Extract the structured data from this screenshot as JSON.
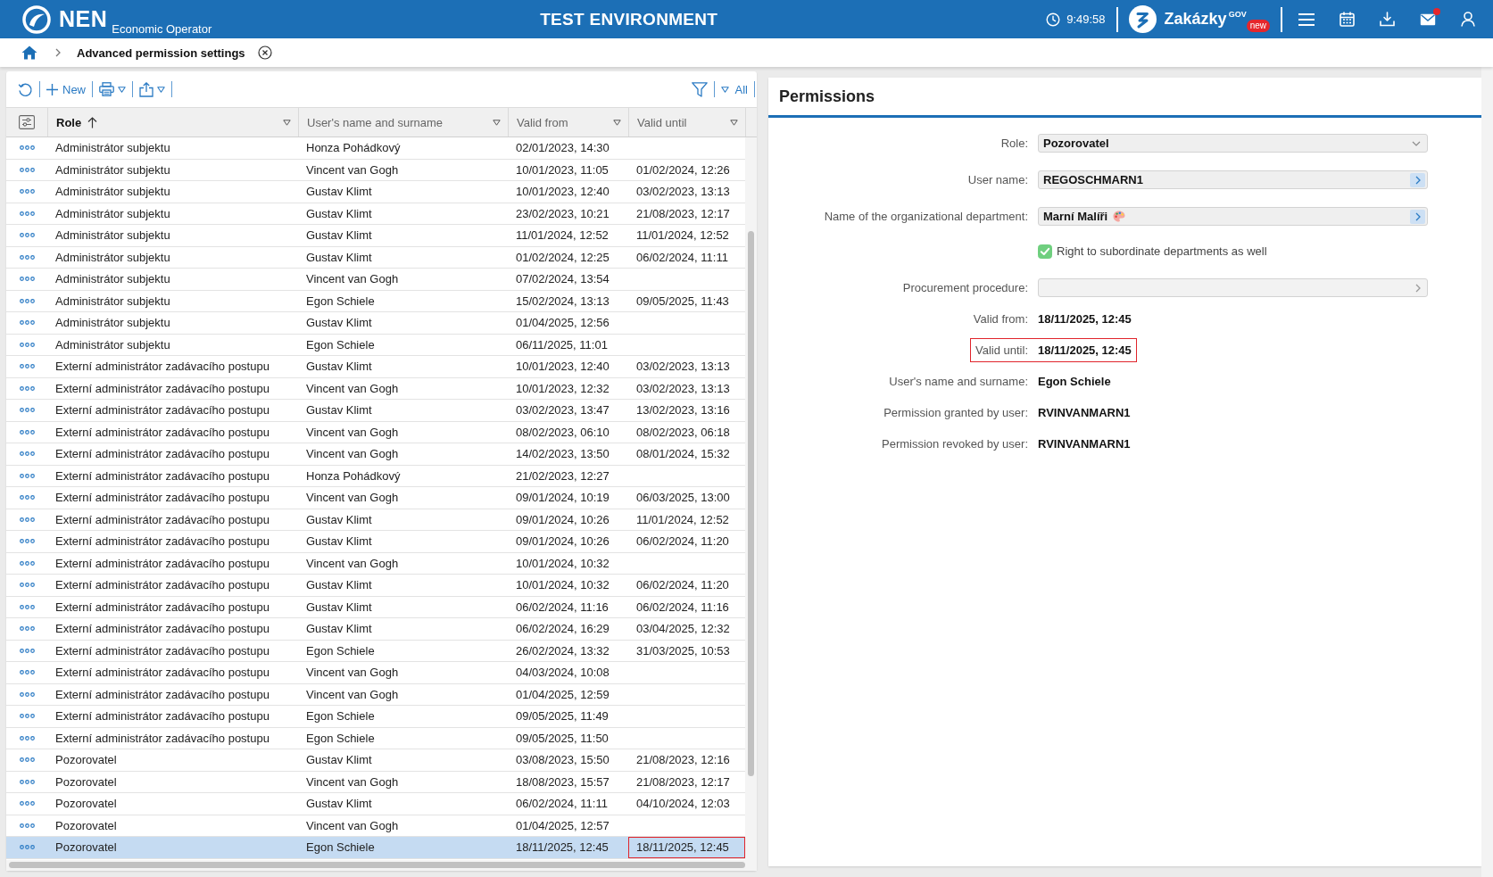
{
  "top_bar": {
    "logo": "NEN",
    "subtitle": "Economic Operator",
    "environment": "TEST ENVIRONMENT",
    "time": "9:49:58",
    "app_name": "Zakázky",
    "app_suffix": "GOV",
    "app_badge": "new",
    "mail_unread": true
  },
  "breadcrumb": {
    "current": "Advanced permission settings"
  },
  "toolbar": {
    "new_label": "New",
    "filter_label": "All"
  },
  "table": {
    "columns": [
      {
        "label": "Role",
        "sorted": true
      },
      {
        "label": "User's name and surname",
        "sorted": false
      },
      {
        "label": "Valid from",
        "sorted": false
      },
      {
        "label": "Valid until",
        "sorted": false
      }
    ],
    "rows": [
      {
        "role": "Administrátor subjektu",
        "user": "Honza Pohádkový",
        "valid_from": "02/01/2023, 14:30",
        "selected": false,
        "highlighted": false
      },
      {
        "role": "Administrátor subjektu",
        "user": "Vincent van Gogh",
        "valid_from": "10/01/2023, 11:05",
        "valid_until": "01/02/2024, 12:26",
        "selected": false,
        "highlighted": false
      },
      {
        "role": "Administrátor subjektu",
        "user": "Gustav Klimt",
        "valid_from": "10/01/2023, 12:40",
        "valid_until": "03/02/2023, 13:13",
        "selected": false,
        "highlighted": false
      },
      {
        "role": "Administrátor subjektu",
        "user": "Gustav Klimt",
        "valid_from": "23/02/2023, 10:21",
        "valid_until": "21/08/2023, 12:17",
        "selected": false,
        "highlighted": false
      },
      {
        "role": "Administrátor subjektu",
        "user": "Gustav Klimt",
        "valid_from": "11/01/2024, 12:52",
        "valid_until": "11/01/2024, 12:52",
        "selected": false,
        "highlighted": false
      },
      {
        "role": "Administrátor subjektu",
        "user": "Gustav Klimt",
        "valid_from": "01/02/2024, 12:25",
        "valid_until": "06/02/2024, 11:11",
        "selected": false,
        "highlighted": false
      },
      {
        "role": "Administrátor subjektu",
        "user": "Vincent van Gogh",
        "valid_from": "07/02/2024, 13:54",
        "selected": false,
        "highlighted": false
      },
      {
        "role": "Administrátor subjektu",
        "user": "Egon Schiele",
        "valid_from": "15/02/2024, 13:13",
        "valid_until": "09/05/2025, 11:43",
        "selected": false,
        "highlighted": false
      },
      {
        "role": "Administrátor subjektu",
        "user": "Gustav Klimt",
        "valid_from": "01/04/2025, 12:56",
        "selected": false,
        "highlighted": false
      },
      {
        "role": "Administrátor subjektu",
        "user": "Egon Schiele",
        "valid_from": "06/11/2025, 11:01",
        "selected": false,
        "highlighted": false
      },
      {
        "role": "Externí administrátor zadávacího postupu",
        "user": "Gustav Klimt",
        "valid_from": "10/01/2023, 12:40",
        "valid_until": "03/02/2023, 13:13",
        "selected": false,
        "highlighted": false
      },
      {
        "role": "Externí administrátor zadávacího postupu",
        "user": "Vincent van Gogh",
        "valid_from": "10/01/2023, 12:32",
        "valid_until": "03/02/2023, 13:13",
        "selected": false,
        "highlighted": false
      },
      {
        "role": "Externí administrátor zadávacího postupu",
        "user": "Gustav Klimt",
        "valid_from": "03/02/2023, 13:47",
        "valid_until": "13/02/2023, 13:16",
        "selected": false,
        "highlighted": false
      },
      {
        "role": "Externí administrátor zadávacího postupu",
        "user": "Vincent van Gogh",
        "valid_from": "08/02/2023, 06:10",
        "valid_until": "08/02/2023, 06:18",
        "selected": false,
        "highlighted": false
      },
      {
        "role": "Externí administrátor zadávacího postupu",
        "user": "Vincent van Gogh",
        "valid_from": "14/02/2023, 13:50",
        "valid_until": "08/01/2024, 15:32",
        "selected": false,
        "highlighted": false
      },
      {
        "role": "Externí administrátor zadávacího postupu",
        "user": "Honza Pohádkový",
        "valid_from": "21/02/2023, 12:27",
        "selected": false,
        "highlighted": false
      },
      {
        "role": "Externí administrátor zadávacího postupu",
        "user": "Vincent van Gogh",
        "valid_from": "09/01/2024, 10:19",
        "valid_until": "06/03/2025, 13:00",
        "selected": false,
        "highlighted": false
      },
      {
        "role": "Externí administrátor zadávacího postupu",
        "user": "Gustav Klimt",
        "valid_from": "09/01/2024, 10:26",
        "valid_until": "11/01/2024, 12:52",
        "selected": false,
        "highlighted": false
      },
      {
        "role": "Externí administrátor zadávacího postupu",
        "user": "Gustav Klimt",
        "valid_from": "09/01/2024, 10:26",
        "valid_until": "06/02/2024, 11:20",
        "selected": false,
        "highlighted": false
      },
      {
        "role": "Externí administrátor zadávacího postupu",
        "user": "Vincent van Gogh",
        "valid_from": "10/01/2024, 10:32",
        "selected": false,
        "highlighted": false
      },
      {
        "role": "Externí administrátor zadávacího postupu",
        "user": "Gustav Klimt",
        "valid_from": "10/01/2024, 10:32",
        "valid_until": "06/02/2024, 11:20",
        "selected": false,
        "highlighted": false
      },
      {
        "role": "Externí administrátor zadávacího postupu",
        "user": "Gustav Klimt",
        "valid_from": "06/02/2024, 11:16",
        "valid_until": "06/02/2024, 11:16",
        "selected": false,
        "highlighted": false
      },
      {
        "role": "Externí administrátor zadávacího postupu",
        "user": "Gustav Klimt",
        "valid_from": "06/02/2024, 16:29",
        "valid_until": "03/04/2025, 12:32",
        "selected": false,
        "highlighted": false
      },
      {
        "role": "Externí administrátor zadávacího postupu",
        "user": "Egon Schiele",
        "valid_from": "26/02/2024, 13:32",
        "valid_until": "31/03/2025, 10:53",
        "selected": false,
        "highlighted": false
      },
      {
        "role": "Externí administrátor zadávacího postupu",
        "user": "Vincent van Gogh",
        "valid_from": "04/03/2024, 10:08",
        "selected": false,
        "highlighted": false
      },
      {
        "role": "Externí administrátor zadávacího postupu",
        "user": "Vincent van Gogh",
        "valid_from": "01/04/2025, 12:59",
        "selected": false,
        "highlighted": false
      },
      {
        "role": "Externí administrátor zadávacího postupu",
        "user": "Egon Schiele",
        "valid_from": "09/05/2025, 11:49",
        "selected": false,
        "highlighted": false
      },
      {
        "role": "Externí administrátor zadávacího postupu",
        "user": "Egon Schiele",
        "valid_from": "09/05/2025, 11:50",
        "selected": false,
        "highlighted": false
      },
      {
        "role": "Pozorovatel",
        "user": "Gustav Klimt",
        "valid_from": "03/08/2023, 15:50",
        "valid_until": "21/08/2023, 12:16",
        "selected": false,
        "highlighted": false
      },
      {
        "role": "Pozorovatel",
        "user": "Vincent van Gogh",
        "valid_from": "18/08/2023, 15:57",
        "valid_until": "21/08/2023, 12:17",
        "selected": false,
        "highlighted": false
      },
      {
        "role": "Pozorovatel",
        "user": "Gustav Klimt",
        "valid_from": "06/02/2024, 11:11",
        "valid_until": "04/10/2024, 12:03",
        "selected": false,
        "highlighted": false
      },
      {
        "role": "Pozorovatel",
        "user": "Vincent van Gogh",
        "valid_from": "01/04/2025, 12:57",
        "selected": false,
        "highlighted": false
      },
      {
        "role": "Pozorovatel",
        "user": "Egon Schiele",
        "valid_from": "18/11/2025, 12:45",
        "valid_until": "18/11/2025, 12:45",
        "selected": true,
        "highlighted": true
      }
    ]
  },
  "permissions": {
    "title": "Permissions",
    "fields": [
      {
        "kind": "select",
        "label": "Role:",
        "value": "Pozorovatel"
      },
      {
        "kind": "lookup",
        "label": "User name:",
        "value": "REGOSCHMARN1",
        "disabled": false,
        "has_icon": false
      },
      {
        "kind": "lookup",
        "label": "Name of the organizational department:",
        "value": "Marní Malíři",
        "disabled": false,
        "has_icon": true
      },
      {
        "kind": "checkbox",
        "label": "Right to subordinate departments as well",
        "checked": true
      },
      {
        "kind": "lookup",
        "label": "Procurement procedure:",
        "disabled": true,
        "has_icon": false
      },
      {
        "kind": "text",
        "label": "Valid from:",
        "value": "18/11/2025, 12:45",
        "highlighted": false
      },
      {
        "kind": "text",
        "label": "Valid until:",
        "value": "18/11/2025, 12:45",
        "highlighted": true
      },
      {
        "kind": "text",
        "label": "User's name and surname:",
        "value": "Egon Schiele",
        "highlighted": false
      },
      {
        "kind": "text",
        "label": "Permission granted by user:",
        "value": "RVINVANMARN1",
        "highlighted": false
      },
      {
        "kind": "text",
        "label": "Permission revoked by user:",
        "value": "RVINVANMARN1",
        "highlighted": false
      }
    ]
  }
}
